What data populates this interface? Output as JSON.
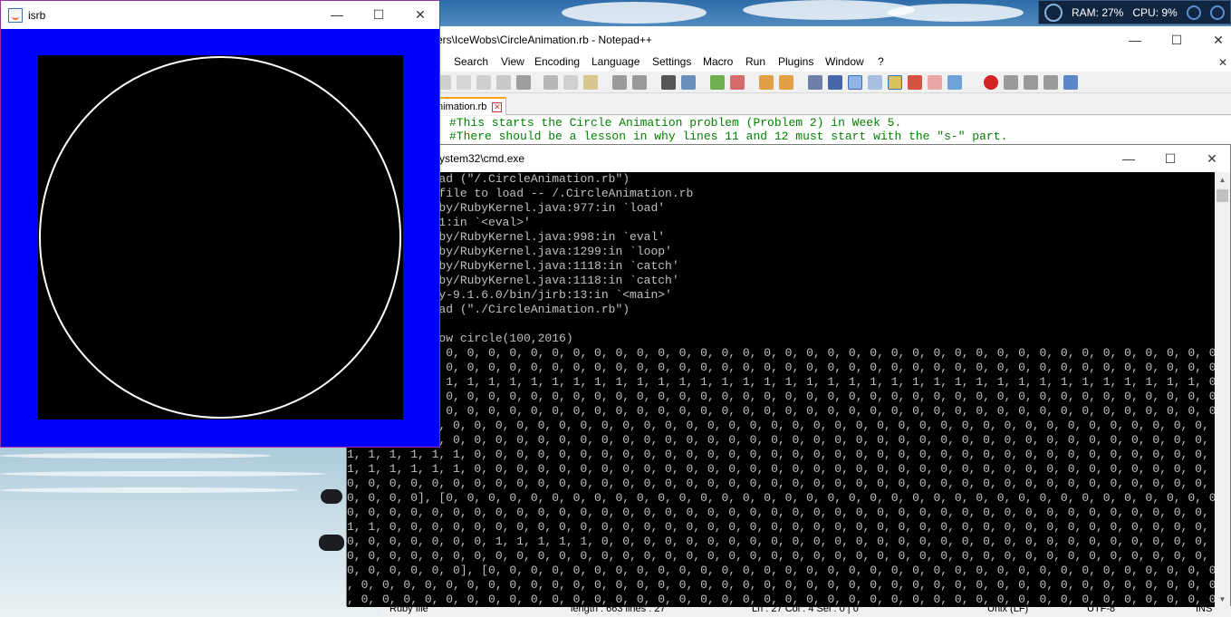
{
  "desktop": {
    "meter": {
      "ram": "RAM: 27%",
      "cpu": "CPU: 9%"
    }
  },
  "npp": {
    "title": "ers\\IceWobs\\CircleAnimation.rb - Notepad++",
    "menu": [
      "Search",
      "View",
      "Encoding",
      "Language",
      "Settings",
      "Macro",
      "Run",
      "Plugins",
      "Window",
      "?"
    ],
    "menu_partial": "e",
    "tab_label": "nimation.rb",
    "code": [
      "#This starts the Circle Animation problem (Problem 2) in Week 5.",
      "#There should be a lesson in why lines 11 and 12 must start with the \"s-\" part."
    ],
    "status": [
      "Ruby file",
      "length : 663   lines : 27",
      "Ln : 27   Col : 4   Sel : 0 | 0",
      "Unix (LF)",
      "UTF-8",
      "INS"
    ]
  },
  "cmd": {
    "title": "ystem32\\cmd.exe",
    "lines": [
      "      1:0> load (\"/.CircleAnimation.rb\")",
      "      o such file to load -- /.CircleAnimation.rb",
      "      org/jruby/RubyKernel.java:977:in `load'",
      "      (isrb):1:in `<eval>'",
      "      org/jruby/RubyKernel.java:998:in `eval'",
      "      org/jruby/RubyKernel.java:1299:in `loop'",
      "      org/jruby/RubyKernel.java:1118:in `catch'",
      "      org/jruby/RubyKernel.java:1118:in `catch'",
      "      C:/jruby-9.1.6.0/bin/jirb:13:in `<main>'",
      "      2:0> load (\"./CircleAnimation.rb\")",
      "",
      "      3:0> show circle(100,2016)",
      "        0, 0, 0, 0, 0, 0, 0, 0, 0, 0, 0, 0, 0, 0, 0, 0, 0, 0, 0, 0, 0, 0, 0, 0, 0, 0, 0, 0, 0, 0, 0, 0, 0, 0, 0, 0, 0, 0, 0, 0",
      "        0, 0, 0, 0, 0, 0, 0, 0, 0, 0, 0, 0, 0, 0, 0, 0, 0, 0, 0, 0, 0, 0, 0, 0, 0, 0, 0, 0, 0, 0, 0, 0, 0, 0, 0, 0, 0, 0, 0, 0",
      "        1, 1, 1, 1, 1, 1, 1, 1, 1, 1, 1, 1, 1, 1, 1, 1, 1, 1, 1, 1, 1, 1, 1, 1, 1, 1, 1, 1, 1, 1, 1, 1, 1, 1, 1, 1, 1, 1, 0, 0",
      "        0, 0, 0, 0, 0, 0, 0, 0, 0, 0, 0, 0, 0, 0, 0, 0, 0, 0, 0, 0, 0, 0, 0, 0, 0, 0, 0, 0, 0, 0, 0, 0, 0, 0, 0, 0, 0, 0, 0, 0",
      "        0, 0, 0, 0, 0, 0, 0, 0, 0, 0, 0, 0, 0, 0, 0, 0, 0, 0, 0, 0, 0, 0, 0, 0, 0, 0, 0, 0, 0, 0, 0, 0, 0, 0, 0, 0, 0, 0, 0, 0",
      "      0, 0, 0, 0, 0, 0, 0, 0, 0, 0, 0, 0, 0, 0, 0, 0, 0, 0, 0, 0, 0, 0, 0, 0, 0, 0, 0, 0, 0, 0, 0, 0, 0, 0, 0, 0, 0, 0, 0, 0",
      "      0, 0, 0, 0, 0, 0, 0, 0, 0, 0, 0, 0, 0, 0, 0, 0, 0, 0, 0, 0, 0, 0, 0, 0, 0, 0, 0, 0, 0, 0, 0, 0, 0, 0, 0, 0, 0, 0, 0, 0",
      "1, 1, 1, 1, 1, 1, 0, 0, 0, 0, 0, 0, 0, 0, 0, 0, 0, 0, 0, 0, 0, 0, 0, 0, 0, 0, 0, 0, 0, 0, 0, 0, 0, 0, 0, 0, 0, 0, 0, 0, 0, 0, 0, 0, 0, 0, 0, 0",
      "1, 1, 1, 1, 1, 1, 0, 0, 0, 0, 0, 0, 0, 0, 0, 0, 0, 0, 0, 0, 0, 0, 0, 0, 0, 0, 0, 0, 0, 0, 0, 0, 0, 0, 0, 0, 0, 0, 0, 0, 0, 0, 0, 0, 0, 0, 0, 0",
      "0, 0, 0, 0, 0, 0, 0, 0, 0, 0, 0, 0, 0, 0, 0, 0, 0, 0, 0, 0, 0, 0, 0, 0, 0, 0, 0, 0, 0, 0, 0, 0, 0, 0, 0, 0, 0, 0, 0, 0, 0, 0, 0, 0, 0, 0, 0, 0",
      "0, 0, 0, 0], [0, 0, 0, 0, 0, 0, 0, 0, 0, 0, 0, 0, 0, 0, 0, 0, 0, 0, 0, 0, 0, 0, 0, 0, 0, 0, 0, 0, 0, 0, 0, 0, 0, 0, 0, 0, 0, 0, 0, 0, 0, 0",
      "0, 0, 0, 0, 0, 0, 0, 0, 0, 0, 0, 0, 0, 0, 0, 0, 0, 0, 0, 0, 0, 0, 0, 0, 0, 0, 0, 0, 0, 0, 0, 0, 0, 0, 0, 0, 0, 0, 0, 0, 0, 0, 0, 0, 0, 1, 1,",
      "1, 1, 0, 0, 0, 0, 0, 0, 0, 0, 0, 0, 0, 0, 0, 0, 0, 0, 0, 0, 0, 0, 0, 0, 0, 0, 0, 0, 0, 0, 0, 0, 0, 0, 0, 0, 0, 0, 0, 0, 0, 0, 0, 0, 0, 0, 0, 0",
      "0, 0, 0, 0, 0, 0, 0, 1, 1, 1, 1, 1, 0, 0, 0, 0, 0, 0, 0, 0, 0, 0, 0, 0, 0, 0, 0, 0, 0, 0, 0, 0, 0, 0, 0, 0, 0, 0, 0, 0, 0, 0, 0, 0, 0, 0, 0, 0",
      "0, 0, 0, 0, 0, 0, 0, 0, 0, 0, 0, 0, 0, 0, 0, 0, 0, 0, 0, 0, 0, 0, 0, 0, 0, 0, 0, 0, 0, 0, 0, 0, 0, 0, 0, 0, 0, 0, 0, 0, 0, 0, 0, 0, 0, 0, 0, 0",
      "0, 0, 0, 0, 0, 0], [0, 0, 0, 0, 0, 0, 0, 0, 0, 0, 0, 0, 0, 0, 0, 0, 0, 0, 0, 0, 0, 0, 0, 0, 0, 0, 0, 0, 0, 0, 0, 0, 0, 0, 0, 0, 0, 0, 0, 0",
      ", 0, 0, 0, 0, 0, 0, 0, 0, 0, 0, 0, 0, 0, 0, 0, 0, 0, 0, 0, 0, 0, 0, 0, 0, 0, 0, 0, 0, 0, 0, 0, 0, 0, 0, 0, 0, 0, 0, 0, 0, 0, 0, 0, 1, 1, 1, 1",
      ", 0, 0, 0, 0, 0, 0, 0, 0, 0, 0, 0, 0, 0, 0, 0, 0, 0, 0, 0, 0, 0, 0, 0, 0, 0, 0, 0, 0, 0, 0, 0, 0, 0, 0, 0, 0, 0, 0, 0, 0, 0, 0, 0, 0, 0, 0, 0"
    ]
  },
  "isrb": {
    "title": "isrb",
    "drawing": {
      "shape": "circle",
      "stroke": "#ffffff",
      "background": "#000000",
      "frame": "#0000ff"
    }
  },
  "colors": {
    "frame_blue": "#0000ff",
    "npp_tab_accent": "#f6a31a",
    "comment_green": "#008000"
  }
}
